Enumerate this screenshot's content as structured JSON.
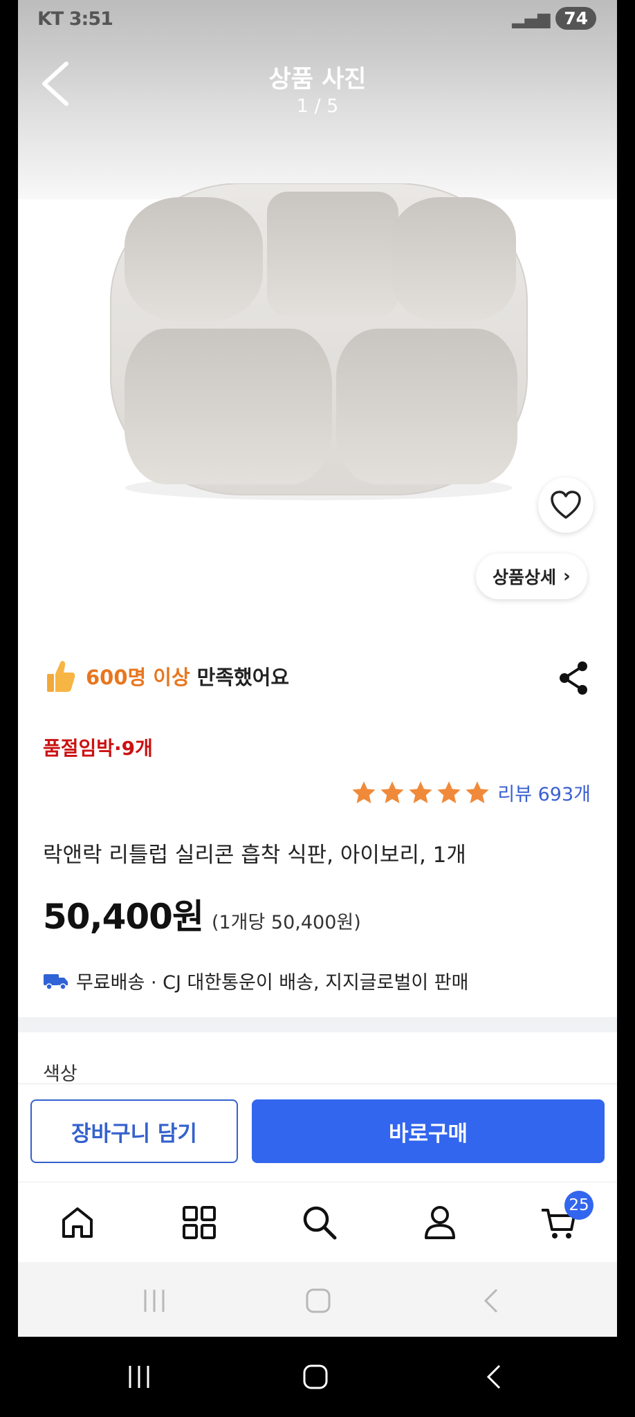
{
  "status_bar": {
    "left_text": "KT 3:51",
    "battery": "74"
  },
  "header": {
    "title": "상품 사진",
    "counter": "1 / 5"
  },
  "product": {
    "detail_button_label": "상품상세",
    "satisfaction_highlight": "600명 이상",
    "satisfaction_rest": "만족했어요",
    "stock_notice": "품절임박·9개",
    "rating_stars": 5,
    "review_count": "리뷰 693개",
    "name": "락앤락 리틀럽 실리콘 흡착 식판, 아이보리, 1개",
    "price": "50,400원",
    "unit_price": "(1개당 50,400원)",
    "delivery_info": "무료배송 · CJ 대한통운이 배송, 지지글로벌이 판매",
    "option_label": "색상"
  },
  "actions": {
    "add_to_cart": "장바구니 담기",
    "buy_now": "바로구매"
  },
  "tab_bar": {
    "items": [
      "home-icon",
      "category-icon",
      "search-icon",
      "user-icon",
      "cart-icon"
    ],
    "cart_badge": "25"
  },
  "colors": {
    "accent_blue": "#3366ee",
    "outline_blue": "#3461cc",
    "stock_red": "#cc1111",
    "highlight_orange": "#e8761f",
    "star_orange": "#f08a3a"
  }
}
